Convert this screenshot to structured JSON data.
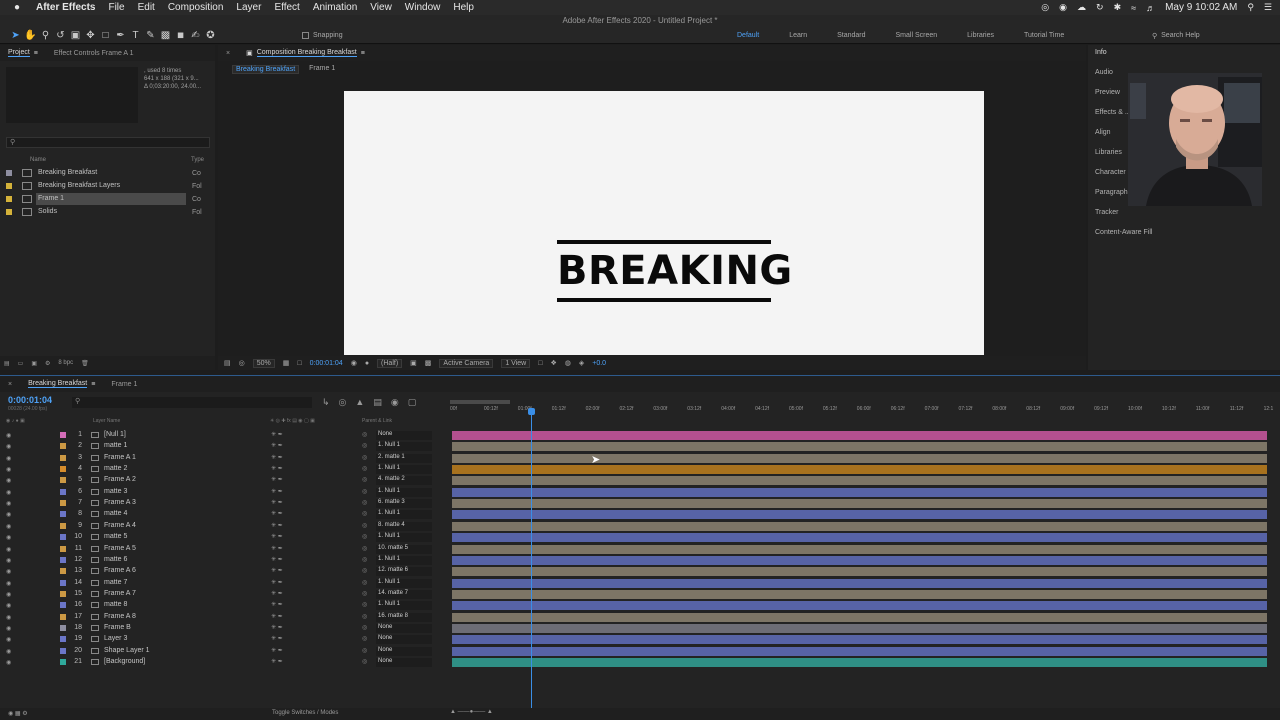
{
  "menubar": {
    "app": "After Effects",
    "items": [
      "File",
      "Edit",
      "Composition",
      "Layer",
      "Effect",
      "Animation",
      "View",
      "Window",
      "Help"
    ],
    "clock": "May 9  10:02 AM"
  },
  "window_title": "Adobe After Effects 2020 - Untitled Project *",
  "toolbar": {
    "snapping": "Snapping",
    "workspaces": [
      "Default",
      "Learn",
      "Standard",
      "Small Screen",
      "Libraries",
      "Tutorial Time"
    ],
    "search": "Search Help"
  },
  "project": {
    "tabs": [
      "Project",
      "Effect Controls Frame A 1"
    ],
    "info_lines": [
      ", used 8 times",
      "641 x 188  (321 x 9...",
      "Δ 0;03:20:00, 24.00..."
    ],
    "header_name": "Name",
    "header_type": "Type",
    "items": [
      {
        "name": "Breaking Breakfast",
        "type": "Co",
        "color": "#8e8ea0"
      },
      {
        "name": "Breaking Breakfast Layers",
        "type": "Fol",
        "color": "#d4b23a"
      },
      {
        "name": "Frame 1",
        "type": "Co",
        "color": "#d4b23a"
      },
      {
        "name": "Solids",
        "type": "Fol",
        "color": "#d4b23a"
      }
    ],
    "bpc": "8 bpc"
  },
  "comp": {
    "tab": "Composition Breaking Breakfast",
    "crumbs": [
      "Breaking Breakfast",
      "Frame 1"
    ],
    "logo_text": "BREAKING",
    "footer": {
      "zoom": "50%",
      "time": "0:00:01:04",
      "quality": "(Half)",
      "camera": "Active Camera",
      "views": "1 View",
      "exposure": "+0.0"
    }
  },
  "right_panel": {
    "items": [
      "Info",
      "Audio",
      "Preview",
      "Effects & ...",
      "Align",
      "Libraries",
      "Character",
      "Paragraph",
      "Tracker",
      "Content-Aware Fill"
    ]
  },
  "timeline": {
    "tabs": [
      "Breaking Breakfast",
      "Frame 1"
    ],
    "timecode": "0:00:01:04",
    "timecode_sub": "00028 (24.00 fps)",
    "col_layer": "Layer Name",
    "col_parent": "Parent & Link",
    "ticks": [
      "00f",
      "00:12f",
      "01:00f",
      "01:12f",
      "02:00f",
      "02:12f",
      "03:00f",
      "03:12f",
      "04:00f",
      "04:12f",
      "05:00f",
      "05:12f",
      "06:00f",
      "06:12f",
      "07:00f",
      "07:12f",
      "08:00f",
      "08:12f",
      "09:00f",
      "09:12f",
      "10:00f",
      "10:12f",
      "11:00f",
      "11:12f",
      "12:1"
    ],
    "footer": "Toggle Switches / Modes",
    "layers": [
      {
        "n": "1",
        "name": "[Null 1]",
        "parent": "None",
        "color": "#d36cb7",
        "bar": "#b4508f"
      },
      {
        "n": "2",
        "name": "matte 1",
        "parent": "1. Null 1",
        "color": "#cc9944",
        "bar": "#7d7566"
      },
      {
        "n": "3",
        "name": "Frame A 1",
        "parent": "2. matte 1",
        "color": "#cc9944",
        "bar": "#7d7566"
      },
      {
        "n": "4",
        "name": "matte 2",
        "parent": "1. Null 1",
        "color": "#d68d2c",
        "bar": "#a8721e"
      },
      {
        "n": "5",
        "name": "Frame A 2",
        "parent": "4. matte 2",
        "color": "#cc9944",
        "bar": "#7d7566"
      },
      {
        "n": "6",
        "name": "matte 3",
        "parent": "1. Null 1",
        "color": "#6b76c8",
        "bar": "#5763a6"
      },
      {
        "n": "7",
        "name": "Frame A 3",
        "parent": "6. matte 3",
        "color": "#cc9944",
        "bar": "#7d7566"
      },
      {
        "n": "8",
        "name": "matte 4",
        "parent": "1. Null 1",
        "color": "#6b76c8",
        "bar": "#5763a6"
      },
      {
        "n": "9",
        "name": "Frame A 4",
        "parent": "8. matte 4",
        "color": "#cc9944",
        "bar": "#7d7566"
      },
      {
        "n": "10",
        "name": "matte 5",
        "parent": "1. Null 1",
        "color": "#6b76c8",
        "bar": "#5763a6"
      },
      {
        "n": "11",
        "name": "Frame A 5",
        "parent": "10. matte 5",
        "color": "#cc9944",
        "bar": "#7d7566"
      },
      {
        "n": "12",
        "name": "matte 6",
        "parent": "1. Null 1",
        "color": "#6b76c8",
        "bar": "#5763a6"
      },
      {
        "n": "13",
        "name": "Frame A 6",
        "parent": "12. matte 6",
        "color": "#cc9944",
        "bar": "#7d7566"
      },
      {
        "n": "14",
        "name": "matte 7",
        "parent": "1. Null 1",
        "color": "#6b76c8",
        "bar": "#5763a6"
      },
      {
        "n": "15",
        "name": "Frame A 7",
        "parent": "14. matte 7",
        "color": "#cc9944",
        "bar": "#7d7566"
      },
      {
        "n": "16",
        "name": "matte 8",
        "parent": "1. Null 1",
        "color": "#6b76c8",
        "bar": "#5763a6"
      },
      {
        "n": "17",
        "name": "Frame A 8",
        "parent": "16. matte 8",
        "color": "#cc9944",
        "bar": "#7d7566"
      },
      {
        "n": "18",
        "name": "Frame B",
        "parent": "None",
        "color": "#8e8ea0",
        "bar": "#6d6d76"
      },
      {
        "n": "19",
        "name": "Layer 3",
        "parent": "None",
        "color": "#6b76c8",
        "bar": "#5763a6"
      },
      {
        "n": "20",
        "name": "Shape Layer 1",
        "parent": "None",
        "color": "#6b76c8",
        "bar": "#5763a6"
      },
      {
        "n": "21",
        "name": "[Background]",
        "parent": "None",
        "color": "#2fa99b",
        "bar": "#2f8f85"
      }
    ]
  }
}
